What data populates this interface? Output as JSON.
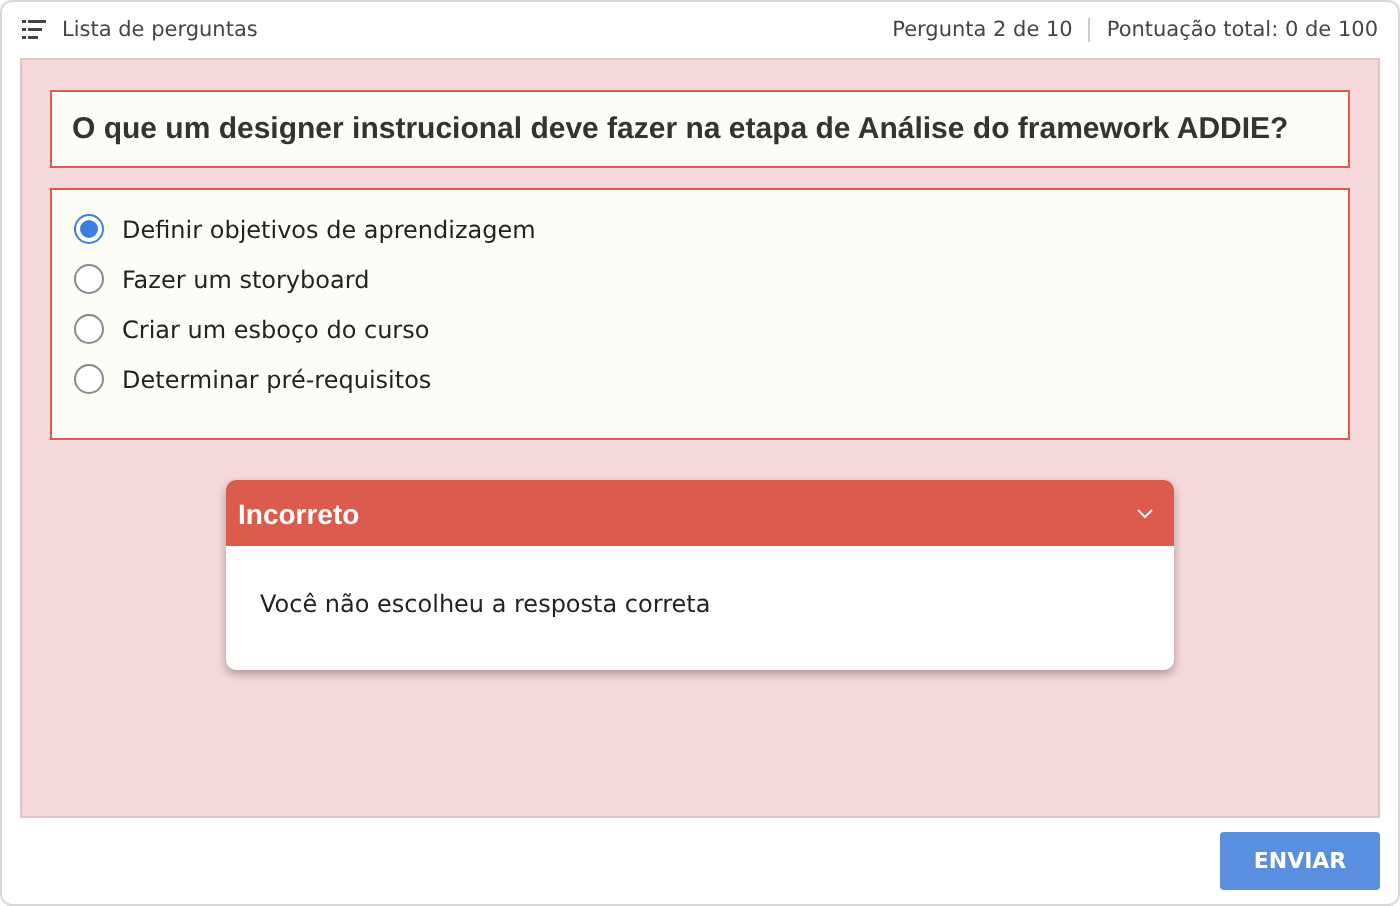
{
  "header": {
    "list_label": "Lista de perguntas",
    "progress": "Pergunta 2 de 10",
    "score": "Pontuação total: 0 de 100"
  },
  "question": "O que um designer instrucional deve fazer na etapa de Análise do framework ADDIE?",
  "options": [
    {
      "label": "Definir objetivos de aprendizagem",
      "selected": true
    },
    {
      "label": "Fazer um storyboard",
      "selected": false
    },
    {
      "label": "Criar um esboço do curso",
      "selected": false
    },
    {
      "label": "Determinar pré-requisitos",
      "selected": false
    }
  ],
  "feedback": {
    "title": "Incorreto",
    "message": "Você não escolheu a resposta correta",
    "expanded": true
  },
  "submit_button": "ENVIAR"
}
